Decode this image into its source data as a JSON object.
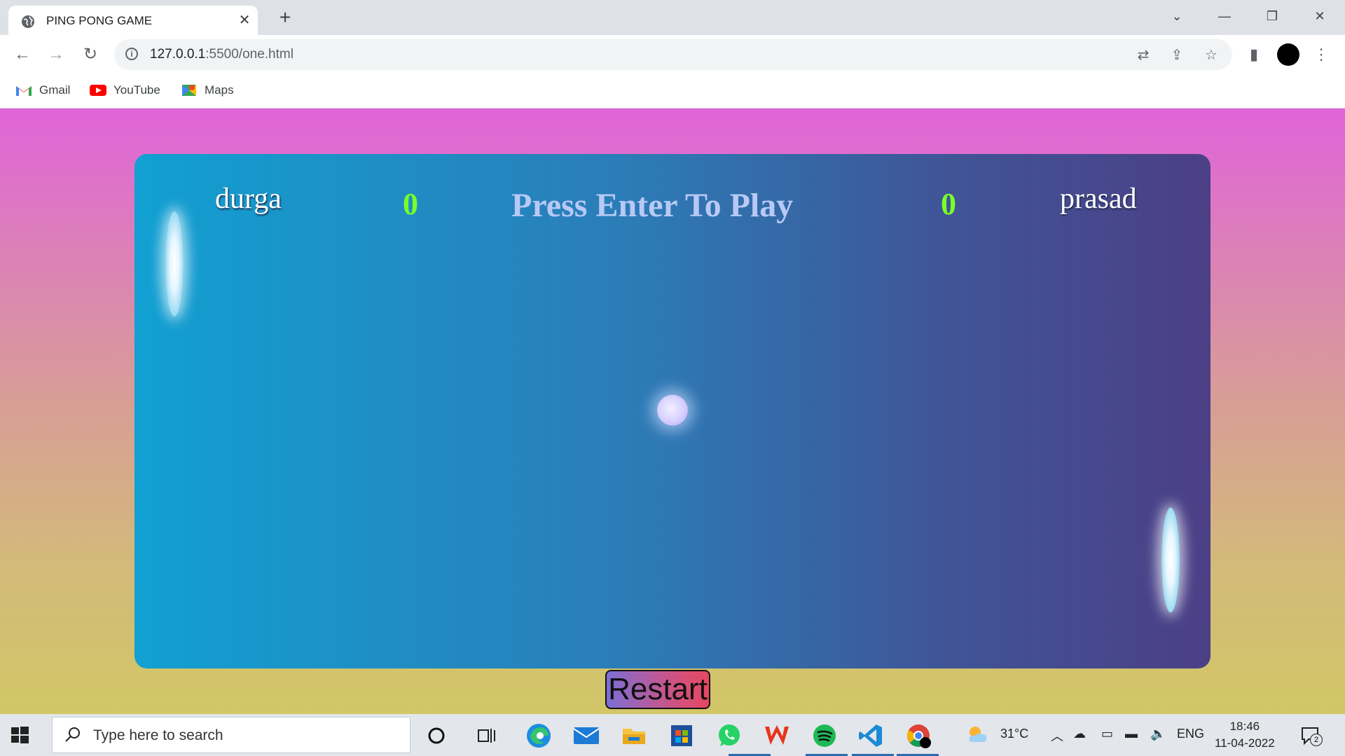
{
  "browser": {
    "tab_title": "PING PONG GAME",
    "tab_close": "✕",
    "new_tab": "+",
    "url_host": "127.0.0.1",
    "url_rest": ":5500/one.html",
    "bookmarks": [
      {
        "label": "Gmail",
        "icon": "gmail-icon"
      },
      {
        "label": "YouTube",
        "icon": "youtube-icon"
      },
      {
        "label": "Maps",
        "icon": "maps-icon"
      }
    ]
  },
  "game": {
    "player_left": "durga",
    "player_right": "prasad",
    "score_left": "0",
    "score_right": "0",
    "message": "Press Enter To Play",
    "restart_label": "Restart",
    "colors": {
      "score": "#7cff26",
      "message": "#b8c9f5",
      "board_start": "#11a0d2",
      "board_end": "#4c3f86"
    }
  },
  "taskbar": {
    "search_placeholder": "Type here to search",
    "temperature": "31°C",
    "language": "ENG",
    "time": "18:46",
    "date": "11-04-2022",
    "notifications": "2",
    "apps": [
      "cortana-icon",
      "task-view-icon",
      "edge-icon",
      "mail-icon",
      "file-explorer-icon",
      "store-icon",
      "whatsapp-icon",
      "wps-icon",
      "spotify-icon",
      "vscode-icon",
      "chrome-icon"
    ]
  }
}
